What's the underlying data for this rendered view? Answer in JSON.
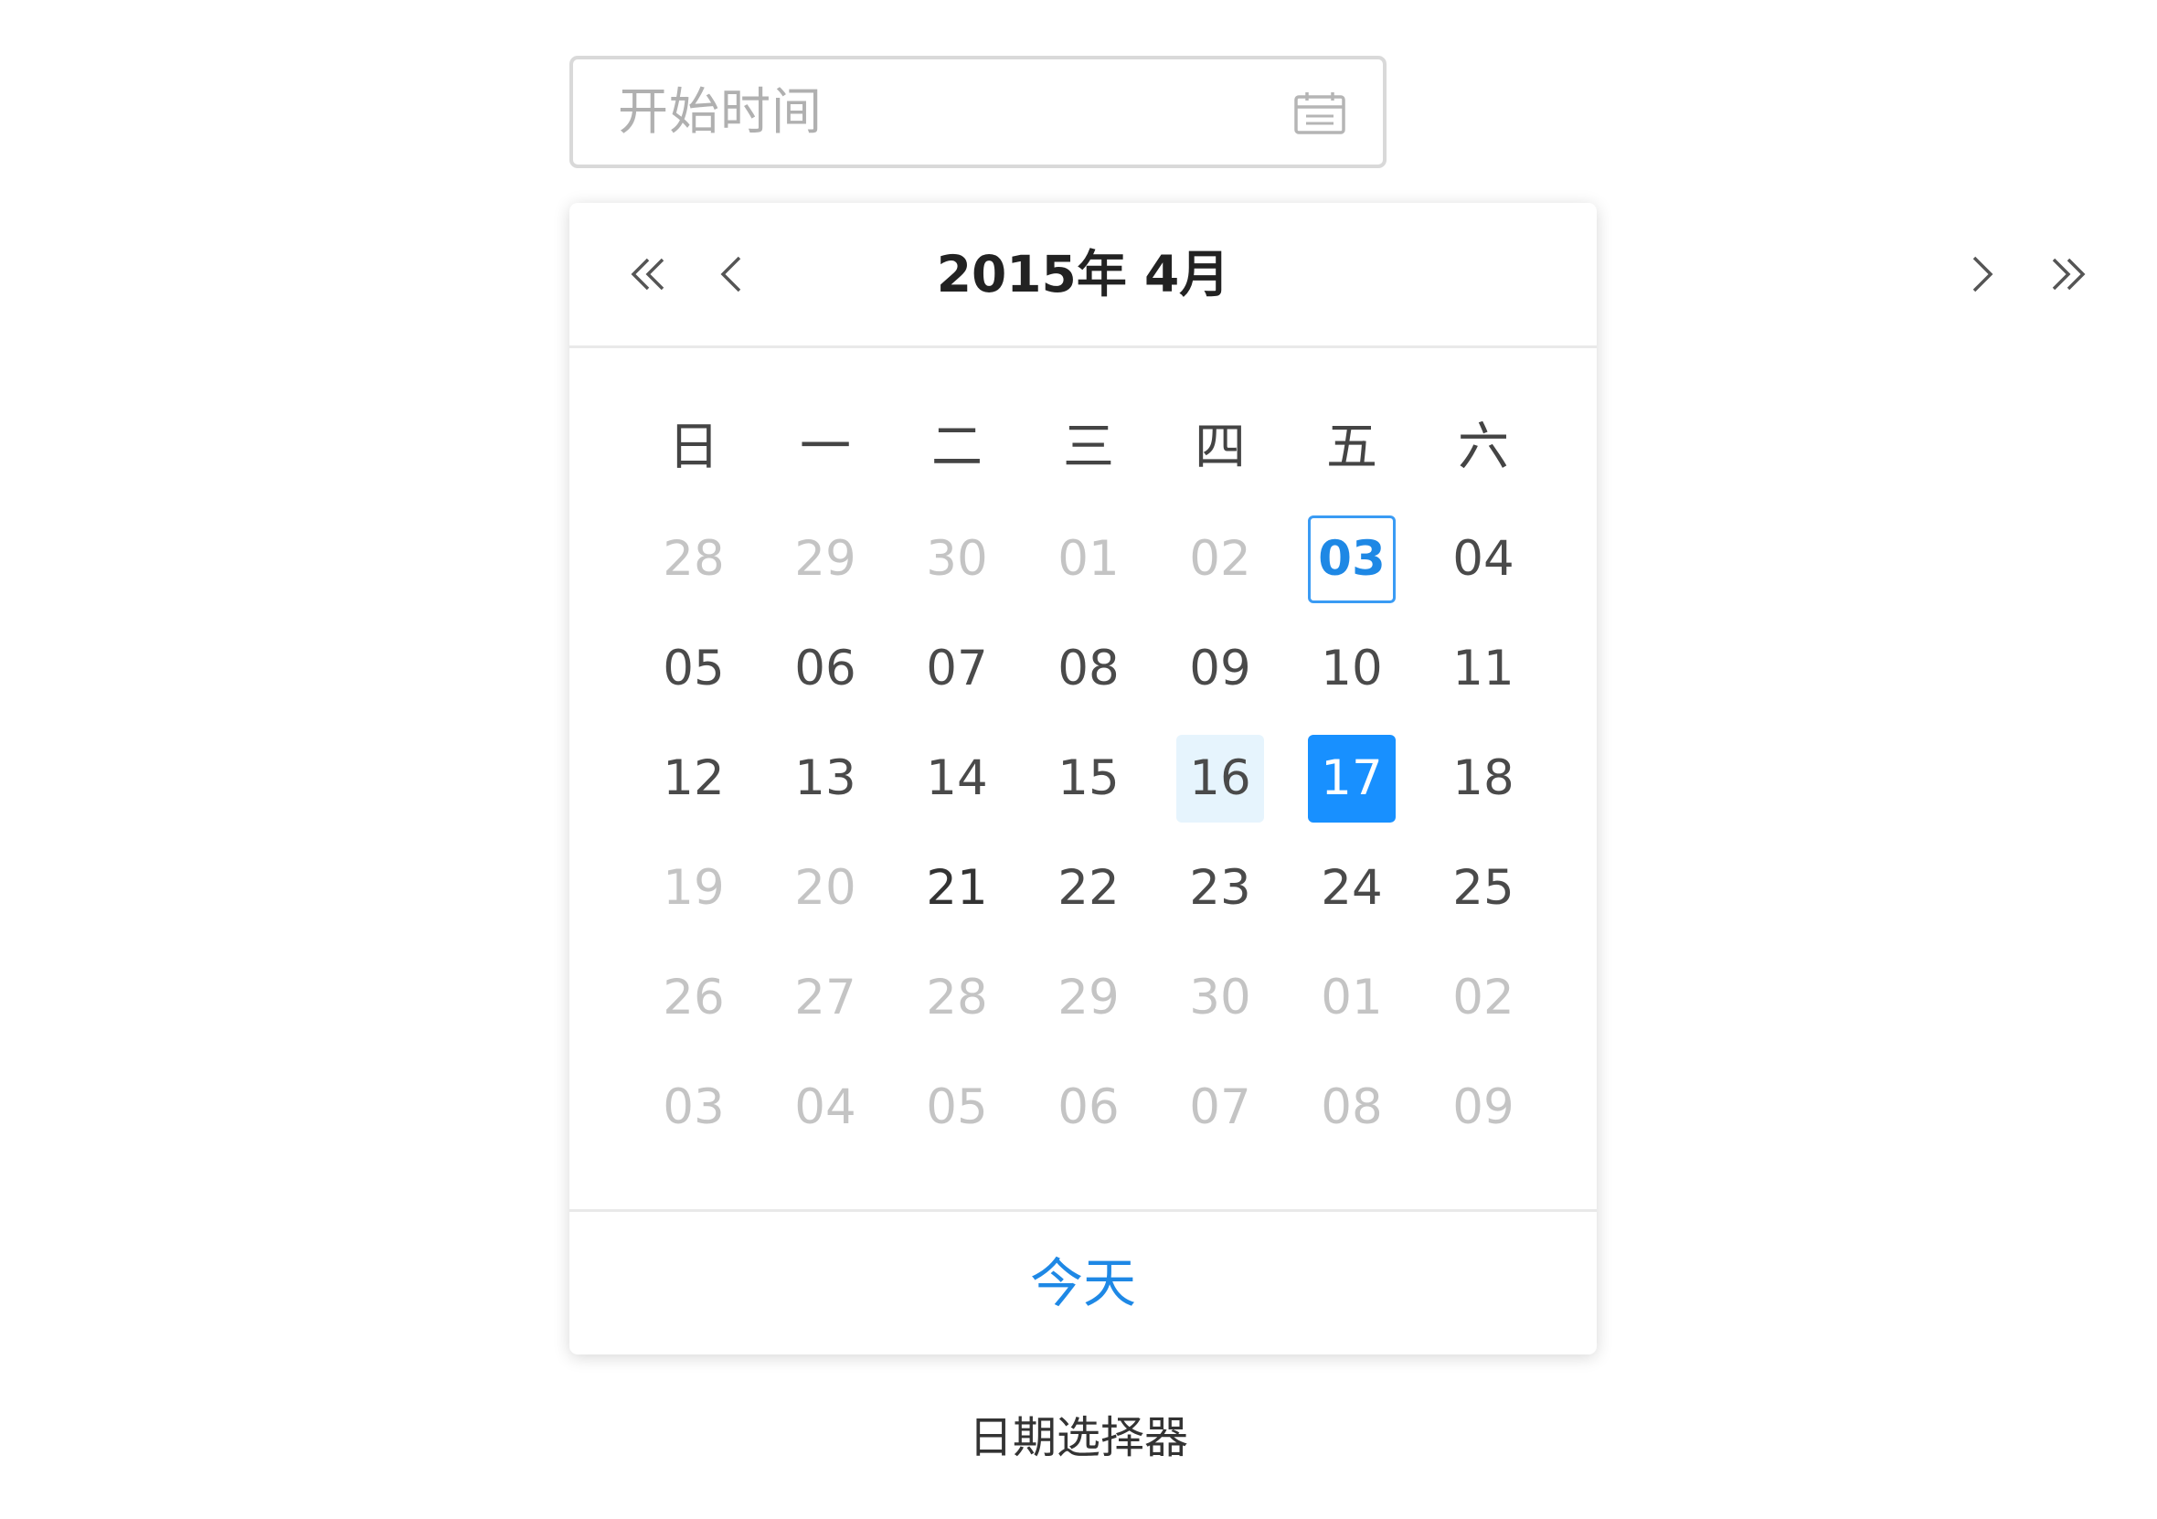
{
  "input": {
    "placeholder": "开始时间",
    "icon": "calendar-icon"
  },
  "header": {
    "title": "2015年 4月",
    "prev_year_icon": "double-chevron-left-icon",
    "prev_month_icon": "chevron-left-icon",
    "next_month_icon": "chevron-right-icon",
    "next_year_icon": "double-chevron-right-icon"
  },
  "weekdays": [
    "日",
    "一",
    "二",
    "三",
    "四",
    "五",
    "六"
  ],
  "days": [
    [
      {
        "label": "28",
        "state": "muted"
      },
      {
        "label": "29",
        "state": "muted"
      },
      {
        "label": "30",
        "state": "muted"
      },
      {
        "label": "01",
        "state": "muted"
      },
      {
        "label": "02",
        "state": "muted"
      },
      {
        "label": "03",
        "state": "today"
      },
      {
        "label": "04",
        "state": "normal"
      }
    ],
    [
      {
        "label": "05",
        "state": "normal"
      },
      {
        "label": "06",
        "state": "normal"
      },
      {
        "label": "07",
        "state": "normal"
      },
      {
        "label": "08",
        "state": "normal"
      },
      {
        "label": "09",
        "state": "normal"
      },
      {
        "label": "10",
        "state": "normal"
      },
      {
        "label": "11",
        "state": "normal"
      }
    ],
    [
      {
        "label": "12",
        "state": "normal"
      },
      {
        "label": "13",
        "state": "normal"
      },
      {
        "label": "14",
        "state": "normal"
      },
      {
        "label": "15",
        "state": "normal"
      },
      {
        "label": "16",
        "state": "hover"
      },
      {
        "label": "17",
        "state": "selected"
      },
      {
        "label": "18",
        "state": "normal"
      }
    ],
    [
      {
        "label": "19",
        "state": "muted"
      },
      {
        "label": "20",
        "state": "muted"
      },
      {
        "label": "21",
        "state": "dark"
      },
      {
        "label": "22",
        "state": "normal"
      },
      {
        "label": "23",
        "state": "normal"
      },
      {
        "label": "24",
        "state": "normal"
      },
      {
        "label": "25",
        "state": "normal"
      }
    ],
    [
      {
        "label": "26",
        "state": "muted"
      },
      {
        "label": "27",
        "state": "muted"
      },
      {
        "label": "28",
        "state": "muted"
      },
      {
        "label": "29",
        "state": "muted"
      },
      {
        "label": "30",
        "state": "muted"
      },
      {
        "label": "01",
        "state": "muted"
      },
      {
        "label": "02",
        "state": "muted"
      }
    ],
    [
      {
        "label": "03",
        "state": "muted"
      },
      {
        "label": "04",
        "state": "muted"
      },
      {
        "label": "05",
        "state": "muted"
      },
      {
        "label": "06",
        "state": "muted"
      },
      {
        "label": "07",
        "state": "muted"
      },
      {
        "label": "08",
        "state": "muted"
      },
      {
        "label": "09",
        "state": "muted"
      }
    ]
  ],
  "footer": {
    "today_label": "今天"
  },
  "caption": "日期选择器",
  "colors": {
    "accent": "#1890ff",
    "today_border": "#3a9bf4",
    "hover_bg": "#e6f4fd",
    "muted_text": "#c4c4c4",
    "placeholder": "#b0b0b0"
  }
}
